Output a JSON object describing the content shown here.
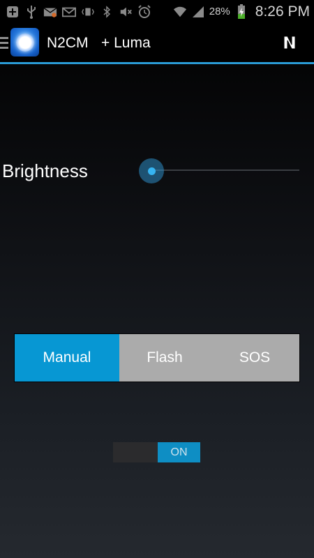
{
  "status_bar": {
    "icons": [
      "add-icon",
      "usb-icon",
      "mail-notification-icon",
      "gmail-icon",
      "vibrate-sound-icon",
      "bluetooth-icon",
      "mute-icon",
      "alarm-icon",
      "wifi-icon",
      "signal-icon",
      "battery-charging-icon"
    ],
    "battery": "28%",
    "time": "8:26 PM"
  },
  "action_bar": {
    "title": "N2CM",
    "subtitle": "+ Luma",
    "accent_color": "#2a9bd6"
  },
  "brightness": {
    "label": "Brightness",
    "value": 0
  },
  "modes": {
    "options": [
      "Manual",
      "Flash",
      "SOS"
    ],
    "selected": "Manual",
    "active_color": "#0797d3",
    "inactive_color": "#ababab"
  },
  "power_toggle": {
    "label": "ON",
    "state": "on"
  }
}
